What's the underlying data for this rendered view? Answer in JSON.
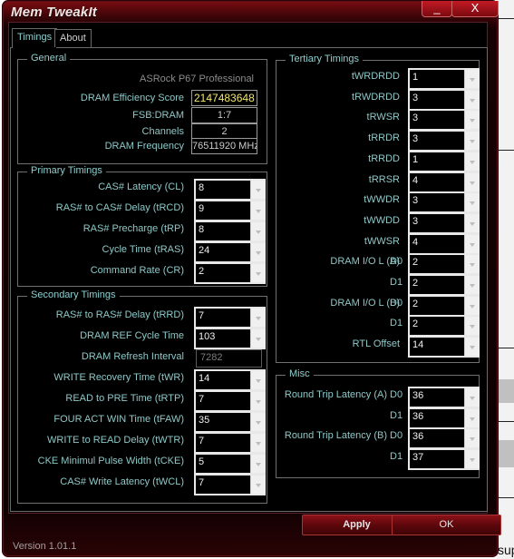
{
  "window": {
    "title": "Mem TweakIt",
    "minimize_label": "_",
    "close_label": "X",
    "version": "Version 1.01.1"
  },
  "tabs": [
    {
      "label": "Timings",
      "active": true
    },
    {
      "label": "About",
      "active": false
    }
  ],
  "general": {
    "title": "General",
    "board": "ASRock P67 Professional",
    "fields": [
      {
        "label": "DRAM Efficiency Score",
        "value": "2147483648"
      },
      {
        "label": "FSB:DRAM",
        "value": "1:7"
      },
      {
        "label": "Channels",
        "value": "2"
      },
      {
        "label": "DRAM Frequency",
        "value": "76511920 MHz"
      }
    ]
  },
  "primary": {
    "title": "Primary Timings",
    "fields": [
      {
        "label": "CAS# Latency (CL)",
        "value": "8"
      },
      {
        "label": "RAS# to CAS# Delay (tRCD)",
        "value": "9"
      },
      {
        "label": "RAS# Precharge (tRP)",
        "value": "8"
      },
      {
        "label": "Cycle Time (tRAS)",
        "value": "24"
      },
      {
        "label": "Command Rate (CR)",
        "value": "2"
      }
    ]
  },
  "secondary": {
    "title": "Secondary Timings",
    "fields": [
      {
        "label": "RAS# to RAS# Delay (tRRD)",
        "value": "7"
      },
      {
        "label": "DRAM REF Cycle Time",
        "value": "103"
      },
      {
        "label": "DRAM Refresh Interval",
        "value": "7282",
        "readonly": true
      },
      {
        "label": "WRITE Recovery Time (tWR)",
        "value": "14"
      },
      {
        "label": "READ to PRE Time (tRTP)",
        "value": "7"
      },
      {
        "label": "FOUR ACT WIN Time (tFAW)",
        "value": "35"
      },
      {
        "label": "WRITE to READ Delay (tWTR)",
        "value": "7"
      },
      {
        "label": "CKE Minimul Pulse Width (tCKE)",
        "value": "5"
      },
      {
        "label": "CAS# Write Latency (tWCL)",
        "value": "7"
      }
    ]
  },
  "tertiary": {
    "title": "Tertiary Timings",
    "fields": [
      {
        "label": "tWRDRDD",
        "value": "1"
      },
      {
        "label": "tRWDRDD",
        "value": "3"
      },
      {
        "label": "tRWSR",
        "value": "3"
      },
      {
        "label": "tRRDR",
        "value": "3"
      },
      {
        "label": "tRRDD",
        "value": "1"
      },
      {
        "label": "tRRSR",
        "value": "4"
      },
      {
        "label": "tWWDR",
        "value": "3"
      },
      {
        "label": "tWWDD",
        "value": "3"
      },
      {
        "label": "tWWSR",
        "value": "4"
      },
      {
        "label": "DRAM I/O L (A)",
        "sub": "D0",
        "value": "2"
      },
      {
        "label": "",
        "sub": "D1",
        "value": "2"
      },
      {
        "label": "DRAM I/O L (B)",
        "sub": "D0",
        "value": "2"
      },
      {
        "label": "",
        "sub": "D1",
        "value": "2"
      },
      {
        "label": "RTL Offset",
        "value": "14"
      }
    ]
  },
  "misc": {
    "title": "Misc",
    "fields": [
      {
        "label": "Round Trip Latency (A)",
        "sub": "D0",
        "value": "36"
      },
      {
        "label": "",
        "sub": "D1",
        "value": "36"
      },
      {
        "label": "Round Trip Latency (B)",
        "sub": "D0",
        "value": "36"
      },
      {
        "label": "",
        "sub": "D1",
        "value": "37"
      }
    ]
  },
  "buttons": {
    "apply": "Apply",
    "ok": "OK"
  },
  "background": {
    "text": "sup"
  }
}
